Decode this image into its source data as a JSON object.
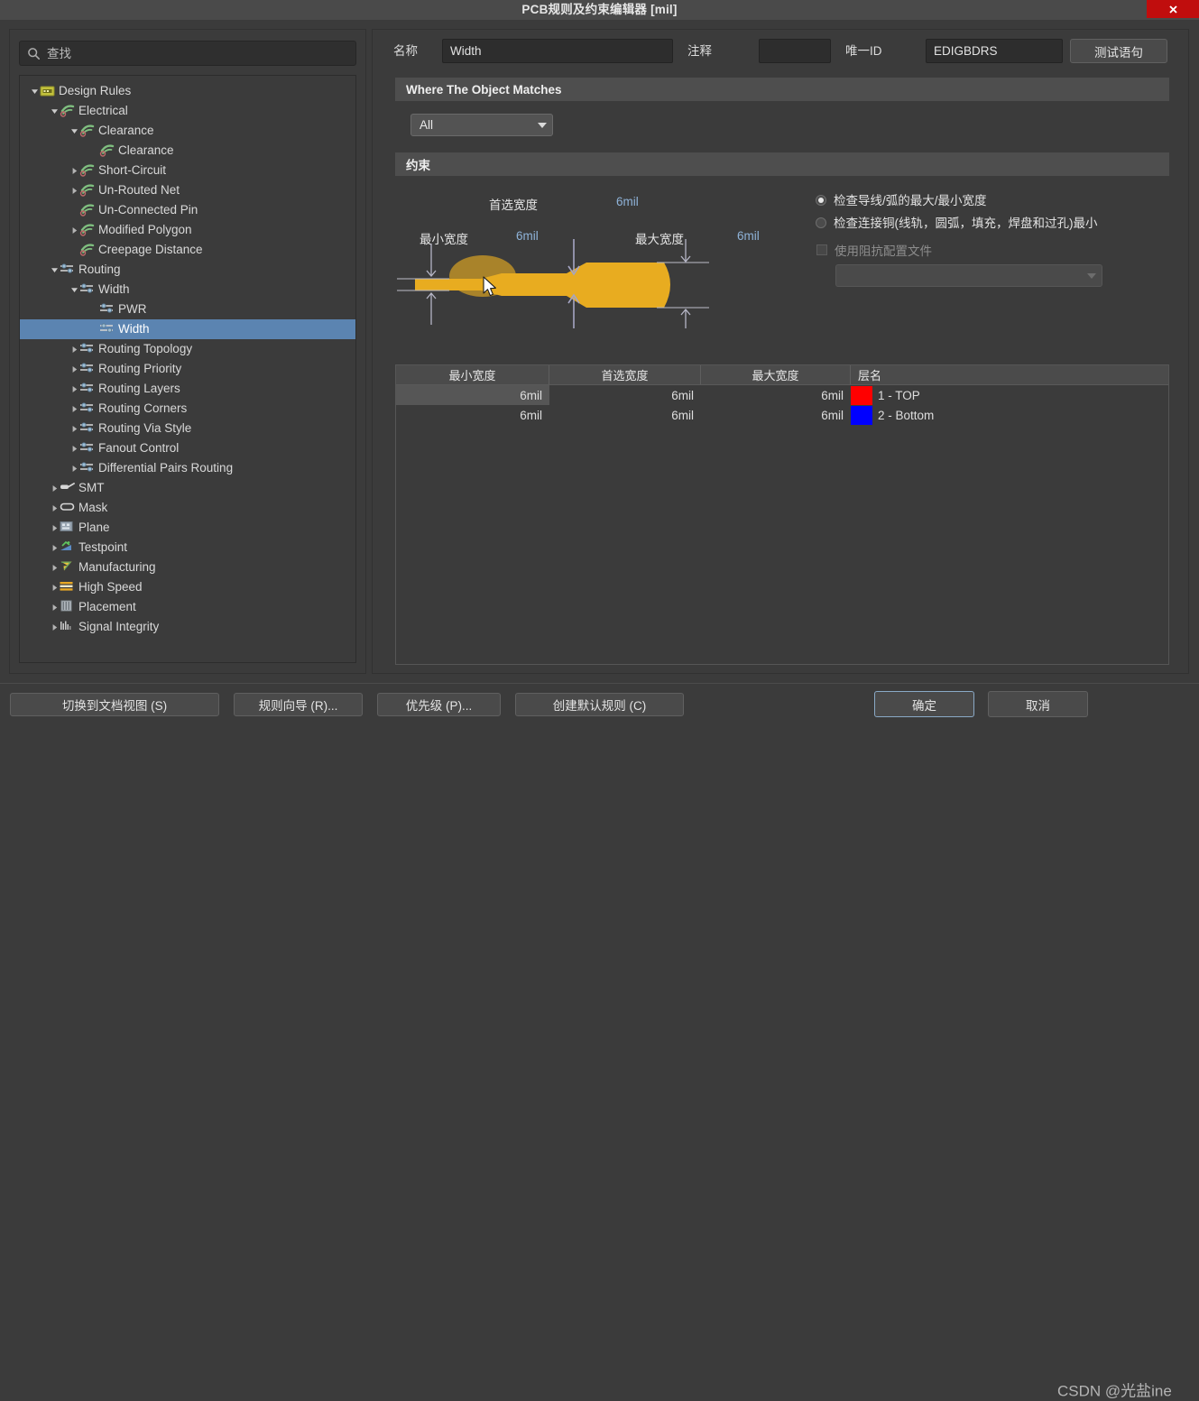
{
  "window": {
    "title": "PCB规则及约束编辑器 [mil]",
    "close_icon": "close-icon"
  },
  "sidebar": {
    "search": {
      "placeholder": "查找",
      "value": "",
      "icon": "search-icon"
    },
    "tree": [
      {
        "label": "Design Rules",
        "depth": 0,
        "arrow": "down",
        "icon": "folder",
        "selected": false
      },
      {
        "label": "Electrical",
        "depth": 1,
        "arrow": "down",
        "icon": "electrical",
        "selected": false
      },
      {
        "label": "Clearance",
        "depth": 2,
        "arrow": "down",
        "icon": "electrical",
        "selected": false
      },
      {
        "label": "Clearance",
        "depth": 3,
        "arrow": "none",
        "icon": "electrical",
        "selected": false
      },
      {
        "label": "Short-Circuit",
        "depth": 2,
        "arrow": "right",
        "icon": "electrical",
        "selected": false
      },
      {
        "label": "Un-Routed Net",
        "depth": 2,
        "arrow": "right",
        "icon": "electrical",
        "selected": false
      },
      {
        "label": "Un-Connected Pin",
        "depth": 2,
        "arrow": "none",
        "icon": "electrical",
        "selected": false
      },
      {
        "label": "Modified Polygon",
        "depth": 2,
        "arrow": "right",
        "icon": "electrical",
        "selected": false
      },
      {
        "label": "Creepage Distance",
        "depth": 2,
        "arrow": "none",
        "icon": "electrical",
        "selected": false
      },
      {
        "label": "Routing",
        "depth": 1,
        "arrow": "down",
        "icon": "routing",
        "selected": false
      },
      {
        "label": "Width",
        "depth": 2,
        "arrow": "down",
        "icon": "routing",
        "selected": false
      },
      {
        "label": "PWR",
        "depth": 3,
        "arrow": "none",
        "icon": "routing",
        "selected": false
      },
      {
        "label": "Width",
        "depth": 3,
        "arrow": "none",
        "icon": "routing",
        "selected": true
      },
      {
        "label": "Routing Topology",
        "depth": 2,
        "arrow": "right",
        "icon": "routing",
        "selected": false
      },
      {
        "label": "Routing Priority",
        "depth": 2,
        "arrow": "right",
        "icon": "routing",
        "selected": false
      },
      {
        "label": "Routing Layers",
        "depth": 2,
        "arrow": "right",
        "icon": "routing",
        "selected": false
      },
      {
        "label": "Routing Corners",
        "depth": 2,
        "arrow": "right",
        "icon": "routing",
        "selected": false
      },
      {
        "label": "Routing Via Style",
        "depth": 2,
        "arrow": "right",
        "icon": "routing",
        "selected": false
      },
      {
        "label": "Fanout Control",
        "depth": 2,
        "arrow": "right",
        "icon": "routing",
        "selected": false
      },
      {
        "label": "Differential Pairs Routing",
        "depth": 2,
        "arrow": "right",
        "icon": "routing",
        "selected": false
      },
      {
        "label": "SMT",
        "depth": 1,
        "arrow": "right",
        "icon": "smt",
        "selected": false
      },
      {
        "label": "Mask",
        "depth": 1,
        "arrow": "right",
        "icon": "mask",
        "selected": false
      },
      {
        "label": "Plane",
        "depth": 1,
        "arrow": "right",
        "icon": "plane",
        "selected": false
      },
      {
        "label": "Testpoint",
        "depth": 1,
        "arrow": "right",
        "icon": "testpoint",
        "selected": false
      },
      {
        "label": "Manufacturing",
        "depth": 1,
        "arrow": "right",
        "icon": "manufacturing",
        "selected": false
      },
      {
        "label": "High Speed",
        "depth": 1,
        "arrow": "right",
        "icon": "highspeed",
        "selected": false
      },
      {
        "label": "Placement",
        "depth": 1,
        "arrow": "right",
        "icon": "placement",
        "selected": false
      },
      {
        "label": "Signal Integrity",
        "depth": 1,
        "arrow": "right",
        "icon": "signalintegrity",
        "selected": false
      }
    ]
  },
  "editor": {
    "name_label": "名称",
    "name_value": "Width",
    "comment_label": "注释",
    "comment_value": "",
    "uid_label": "唯一ID",
    "uid_value": "EDIGBDRS",
    "test_query_button": "测试语句",
    "where_section": "Where The Object Matches",
    "scope_value": "All",
    "constraints_section": "约束",
    "widths": {
      "preferred_label": "首选宽度",
      "preferred_value": "6mil",
      "min_label": "最小宽度",
      "min_value": "6mil",
      "max_label": "最大宽度",
      "max_value": "6mil"
    },
    "options": {
      "radio1_label": "检查导线/弧的最大/最小宽度",
      "radio1_selected": true,
      "radio2_label": "检查连接铜(线轨，圆弧，填充，焊盘和过孔)最小",
      "radio2_selected": false,
      "checkbox_label": "使用阻抗配置文件",
      "checkbox_checked": false,
      "impedance_profile_value": ""
    },
    "table": {
      "columns": [
        "最小宽度",
        "首选宽度",
        "最大宽度",
        "层名"
      ],
      "rows": [
        {
          "min": "6mil",
          "preferred": "6mil",
          "max": "6mil",
          "layer": "1 - TOP",
          "color": "#ff0000",
          "selected": true
        },
        {
          "min": "6mil",
          "preferred": "6mil",
          "max": "6mil",
          "layer": "2 - Bottom",
          "color": "#0000ff",
          "selected": false
        }
      ]
    }
  },
  "footer": {
    "buttons_left": [
      {
        "label": "切换到文档视图 (S)"
      },
      {
        "label": "规则向导 (R)..."
      },
      {
        "label": "优先级 (P)..."
      },
      {
        "label": "创建默认规则 (C)"
      }
    ],
    "ok_button": "确定",
    "cancel_button": "取消",
    "watermark": "CSDN @光盐ine"
  },
  "theme": {
    "accent": "#5b84b1",
    "trace_color": "#e8ac20",
    "close_button": "#c00d0d",
    "value_color": "#8fb3d9"
  }
}
